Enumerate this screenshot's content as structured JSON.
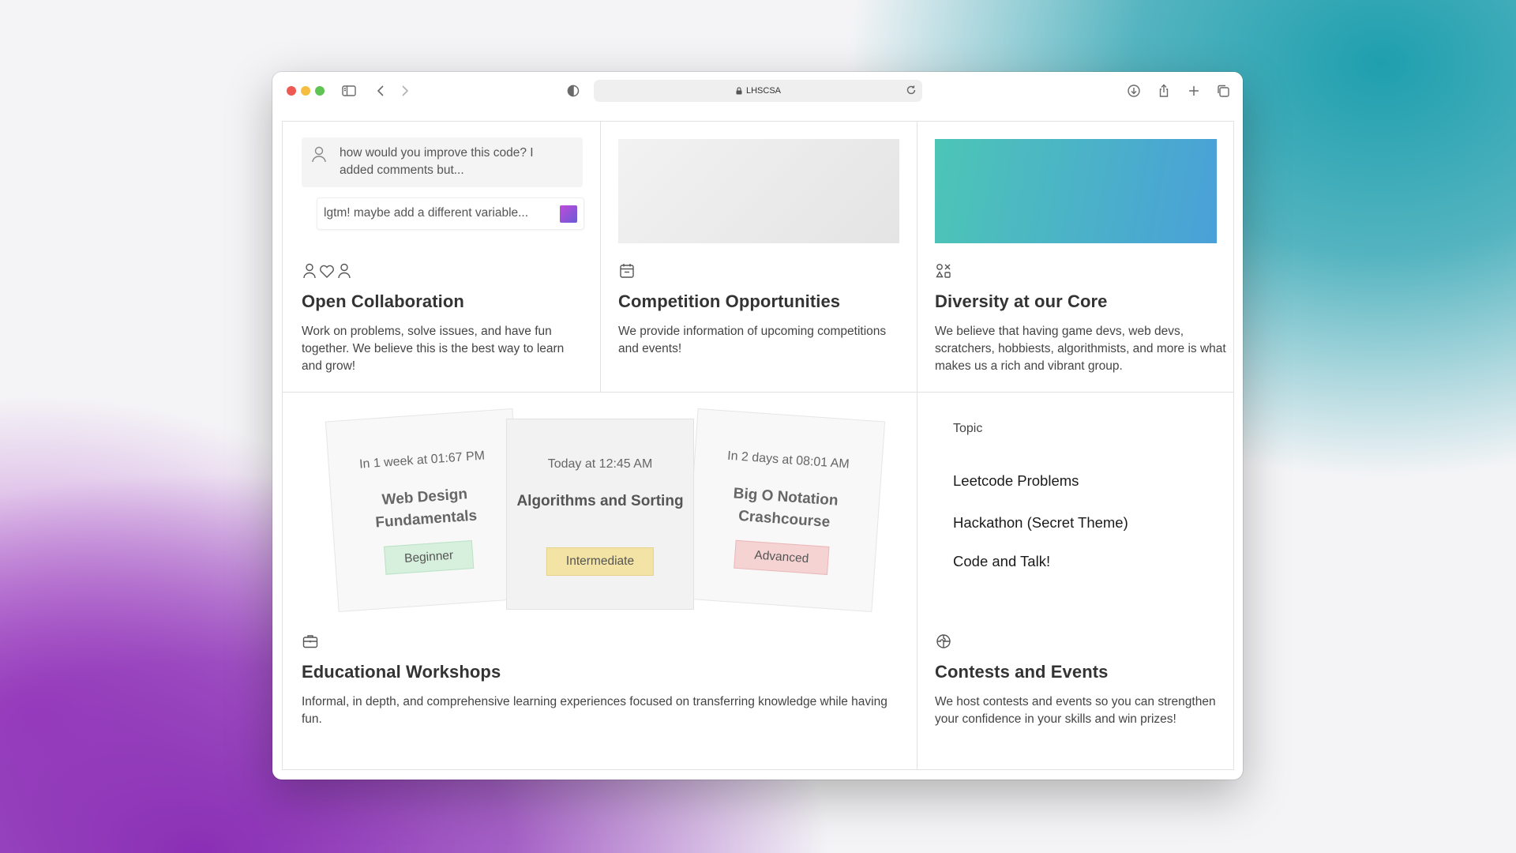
{
  "browser": {
    "url": "LHSCSA",
    "icons": [
      "sidebar-icon",
      "back-icon",
      "forward-icon",
      "shield-icon",
      "lock-icon",
      "reload-icon",
      "download-icon",
      "share-icon",
      "new-tab-icon",
      "tabs-overview-icon"
    ]
  },
  "cards": {
    "collaboration": {
      "chat_message": "how would you improve this code? I added comments but...",
      "chat_reply": "lgtm! maybe add a different variable...",
      "title": "Open Collaboration",
      "description": "Work on problems, solve issues, and have fun together. We believe this is the best way to learn and grow!"
    },
    "competition": {
      "title": "Competition Opportunities",
      "description": "We provide information of upcoming competitions and events!"
    },
    "diversity": {
      "title": "Diversity at our Core",
      "description": "We believe that having game devs, web devs, scratchers, hobbiests, algorithmists, and more is what makes us a rich and vibrant group."
    },
    "workshops": {
      "title": "Educational Workshops",
      "description": "Informal, in depth, and comprehensive learning experiences focused on transferring knowledge while having fun.",
      "items": [
        {
          "when": "In 1 week at 01:67 PM",
          "name": "Web Design Fundamentals",
          "level": "Beginner",
          "level_color": "#d6f0dd"
        },
        {
          "when": "Today at 12:45 AM",
          "name": "Algorithms and Sorting",
          "level": "Intermediate",
          "level_color": "#f3e3a5"
        },
        {
          "when": "In 2 days at 08:01 AM",
          "name": "Big O Notation Crashcourse",
          "level": "Advanced",
          "level_color": "#f6d3d3"
        }
      ]
    },
    "contests": {
      "topic_label": "Topic",
      "topics": [
        "Leetcode Problems",
        "Hackathon (Secret Theme)",
        "Code and Talk!"
      ],
      "title": "Contests and Events",
      "description": "We host contests and events so you can strengthen your confidence in your skills and win prizes!"
    }
  },
  "colors": {
    "diversity_gradient_start": "#4cc5b6",
    "diversity_gradient_end": "#4aa0d8",
    "chat_avatar": "#9c4fd8"
  }
}
